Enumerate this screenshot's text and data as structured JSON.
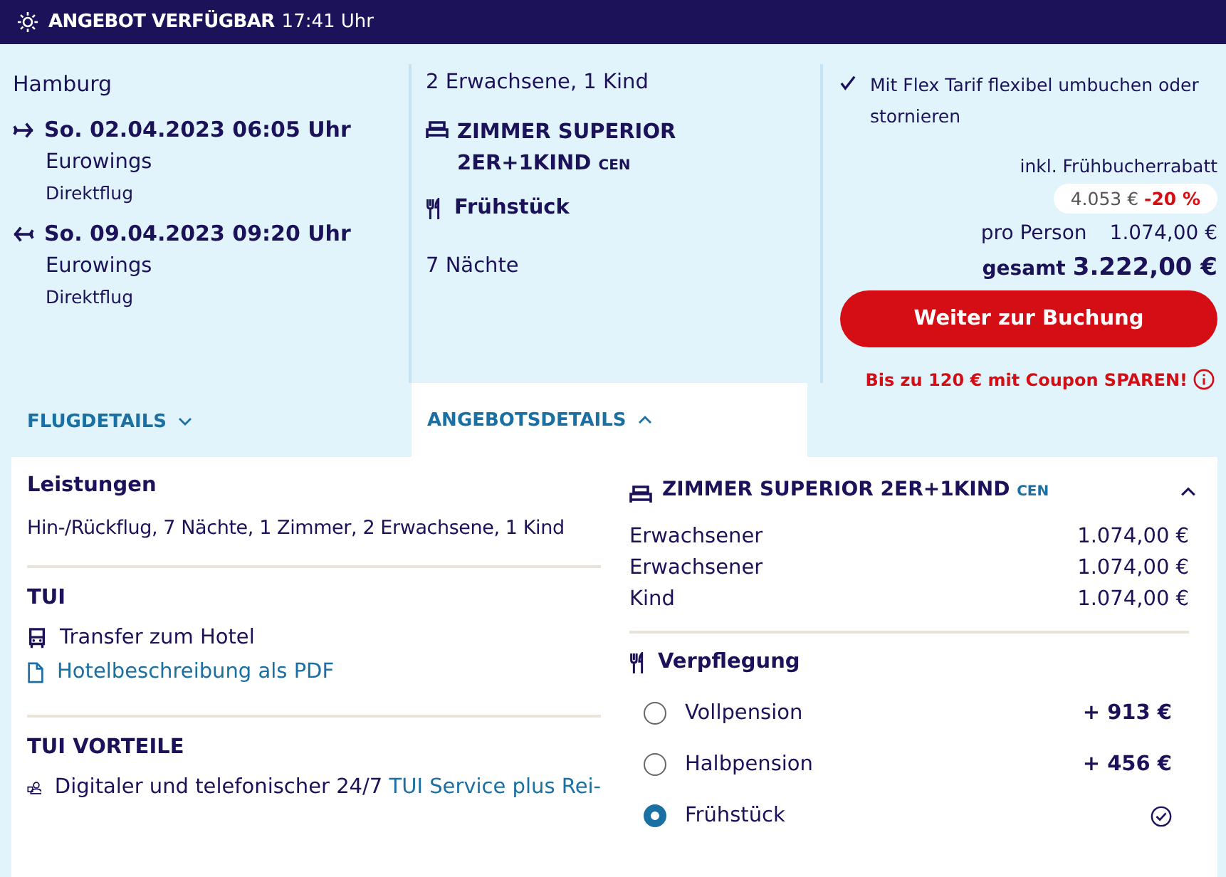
{
  "banner": {
    "title": "ANGEBOT VERFÜGBAR",
    "time": "17:41 Uhr"
  },
  "flight": {
    "origin": "Hamburg",
    "legs": [
      {
        "kind": "outbound",
        "date": "So. 02.04.2023 06:05 Uhr",
        "airline": "Eurowings",
        "type": "Direktflug"
      },
      {
        "kind": "return",
        "date": "So. 09.04.2023 09:20 Uhr",
        "airline": "Eurowings",
        "type": "Direktflug"
      }
    ]
  },
  "offer": {
    "travellers": "2 Erwachsene, 1 Kind",
    "room": "ZIMMER SUPERIOR 2ER+1KIND",
    "room_code": "CEN",
    "board": "Frühstück",
    "nights": "7 Nächte"
  },
  "price": {
    "flex_note": "Mit Flex Tarif flexibel umbuchen oder stornieren",
    "discount_note": "inkl. Frühbucherrabatt",
    "old_price": "4.053 €",
    "discount": "-20 %",
    "per_person_label": "pro Person",
    "per_person": "1.074,00 €",
    "total_label": "gesamt",
    "total": "3.222,00 €",
    "button": "Weiter zur Buchung",
    "coupon": "Bis zu 120 € mit Coupon SPAREN!"
  },
  "tabs": [
    {
      "label": "FLUGDETAILS",
      "selected": false
    },
    {
      "label": "ANGEBOTSDETAILS",
      "selected": true
    }
  ],
  "details": {
    "services_title": "Leistungen",
    "services": "Hin-/Rückflug, 7 Nächte, 1 Zimmer, 2 Erwachsene, 1 Kind",
    "tui_title": "TUI",
    "tui_items": [
      {
        "kind": "bus",
        "text": "Transfer zum Hotel"
      },
      {
        "kind": "link",
        "text": "Hotelbeschreibung als PDF"
      }
    ],
    "advantages_title": "TUI VORTEILE",
    "advantage": {
      "text": "Digitaler und telefonischer 24/7",
      "link": "TUI Service plus Rei-"
    }
  },
  "room_panel": {
    "title": "ZIMMER SUPERIOR 2ER+1KIND",
    "code": "CEN",
    "expanded": true,
    "rows": [
      {
        "label": "Erwachsener",
        "price": "1.074,00 €"
      },
      {
        "label": "Erwachsener",
        "price": "1.074,00 €"
      },
      {
        "label": "Kind",
        "price": "1.074,00 €"
      }
    ],
    "board_title": "Verpflegung",
    "board_options": [
      {
        "label": "Vollpension",
        "price": "+ 913 €",
        "selected": false
      },
      {
        "label": "Halbpension",
        "price": "+ 456 €",
        "selected": false
      },
      {
        "label": "Frühstück",
        "selected": true
      }
    ]
  }
}
